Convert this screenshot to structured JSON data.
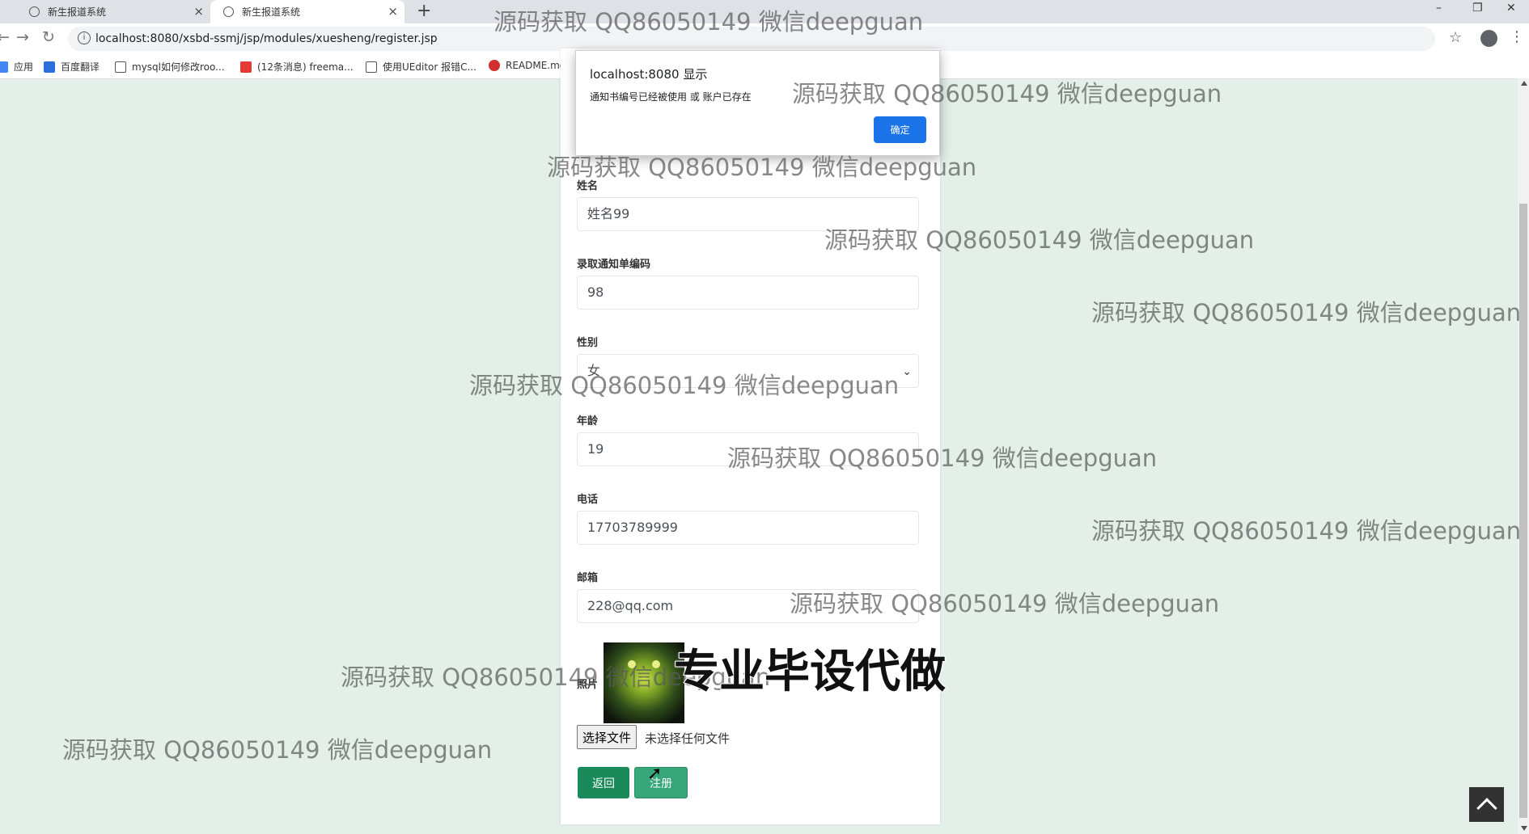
{
  "browser": {
    "tabs": [
      {
        "title": "新生报道系统"
      },
      {
        "title": "新生报道系统"
      }
    ],
    "new_tab_glyph": "+",
    "window_controls": {
      "minimize": "–",
      "restore": "❐",
      "close": "✕"
    },
    "url": "localhost:8080/xsbd-ssmj/jsp/modules/xuesheng/register.jsp",
    "bookmarks": [
      {
        "label": "应用",
        "icon_color": "#4285f4"
      },
      {
        "label": "百度翻译",
        "icon_color": "#2a6fdb"
      },
      {
        "label": "mysql如何修改roo...",
        "icon_color": "#555555"
      },
      {
        "label": "(12条消息) freema...",
        "icon_color": "#e53935"
      },
      {
        "label": "使用UEditor 报错C...",
        "icon_color": "#555555"
      },
      {
        "label": "README.md · ",
        "icon_color": "#d32f2f"
      }
    ]
  },
  "dialog": {
    "title": "localhost:8080 显示",
    "message": "通知书编号已经被使用 或 账户已存在",
    "ok_label": "确定"
  },
  "form": {
    "name_label": "姓名",
    "name_value": "姓名99",
    "notice_label": "录取通知单编码",
    "notice_value": "98",
    "gender_label": "性别",
    "gender_value": "女",
    "age_label": "年龄",
    "age_value": "19",
    "phone_label": "电话",
    "phone_value": "17703789999",
    "email_label": "邮箱",
    "email_value": "228@qq.com",
    "photo_label": "照片",
    "file_button": "选择文件",
    "file_status": "未选择任何文件",
    "back_label": "返回",
    "register_label": "注册"
  },
  "overlay": {
    "watermark": "源码获取 QQ86050149 微信deepguan",
    "promo": "专业毕设代做"
  },
  "colors": {
    "page_bg": "#e3efe8",
    "back_button": "#1a8a5a",
    "register_button": "#37a67a",
    "dialog_ok": "#1a73e8"
  }
}
